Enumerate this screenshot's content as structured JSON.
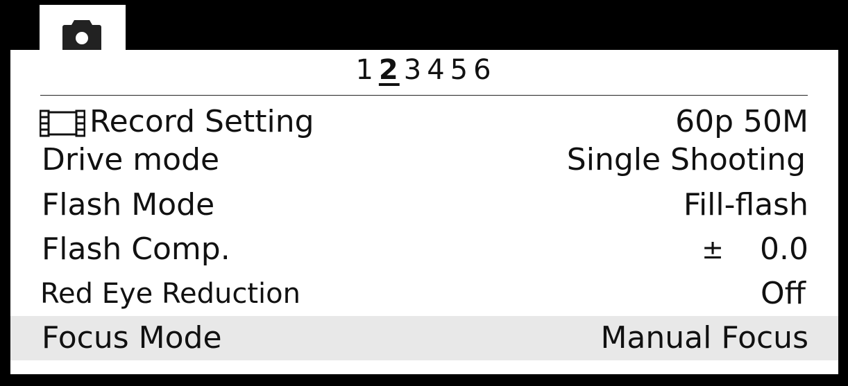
{
  "tab": {
    "icon": "camera-icon"
  },
  "pages": {
    "items": [
      "1",
      "2",
      "3",
      "4",
      "5",
      "6"
    ],
    "current": "2"
  },
  "rows": [
    {
      "label": "Record Setting",
      "value": "60p 50M",
      "icon": "film-icon"
    },
    {
      "label": "Drive mode",
      "value": "Single Shooting"
    },
    {
      "label": "Flash Mode",
      "value": "Fill-flash"
    },
    {
      "label": "Flash Comp.",
      "value_sign": "±",
      "value": "0.0"
    },
    {
      "label": "Red Eye Reduction",
      "value": "Off"
    },
    {
      "label": "Focus Mode",
      "value": "Manual Focus",
      "selected": true
    }
  ],
  "colors": {
    "background": "#000000",
    "panel": "#ffffff",
    "selected_row": "#e8e8e8"
  }
}
